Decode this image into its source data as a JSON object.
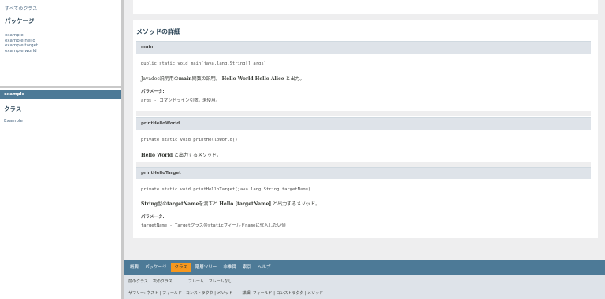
{
  "left": {
    "all_classes": "すべてのクラス",
    "packages_heading": "パッケージ",
    "packages": [
      "example",
      "example.hello",
      "example.target",
      "example.world"
    ],
    "package_bar": "example",
    "classes_heading": "クラス",
    "classes": [
      "Example"
    ]
  },
  "main": {
    "detail_title": "メソッドの詳細",
    "methods": [
      {
        "name": "main",
        "signature": "public static void main(java.lang.String[] args)",
        "desc_parts": [
          "Javadoc説明用の",
          "main",
          "関数の説明。 ",
          "Hello World Hello Alice",
          " と出力。"
        ],
        "params_heading": "パラメータ:",
        "params": "args - コマンドライン引数。未使用。"
      },
      {
        "name": "printHelloWorld",
        "signature": "private static void printHelloWorld()",
        "desc_parts": [
          "Hello World",
          " と出力するメソッド。"
        ]
      },
      {
        "name": "printHelloTarget",
        "signature": "private static void printHelloTarget(java.lang.String targetName)",
        "desc_parts": [
          "String",
          "型の",
          "targetName",
          "を渡すと ",
          "Hello [targetName]",
          " と出力するメソッド。"
        ],
        "params_heading": "パラメータ:",
        "params": "targetName - Targetクラスのstaticフィールドnameに代入したい値"
      }
    ]
  },
  "nav": {
    "top": [
      "概要",
      "パッケージ",
      "クラス",
      "階層ツリー",
      "非推奨",
      "索引",
      "ヘルプ"
    ],
    "active_index": 2,
    "row1": [
      "前のクラス",
      "次のクラス",
      "フレーム",
      "フレームなし"
    ],
    "row2_left": "サマリー: ネスト | フィールド | コンストラクタ | メソッド",
    "row2_right": "詳細: フィールド | コンストラクタ | メソッド"
  },
  "colors": {
    "nav_bar": "#4d7a97",
    "nav_active": "#f8981d",
    "method_header": "#dee3e9",
    "background": "#eeeeef"
  }
}
